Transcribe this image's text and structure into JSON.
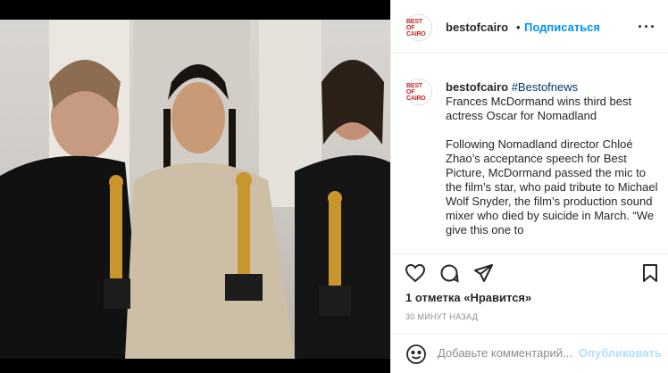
{
  "post": {
    "username": "bestofcairo",
    "avatar_text": "BEST OF CAIRO",
    "dot": "•",
    "follow_label": "Подписаться",
    "more_label": "···"
  },
  "caption": {
    "username": "bestofcairo",
    "hashtag": "#Bestofnews",
    "headline": "Frances McDormand wins third best actress Oscar for Nomadland",
    "body": "Following Nomadland director Chloé Zhao’s acceptance speech for Best Picture, McDormand passed the mic to the film’s star, who paid tribute to Michael Wolf Snyder, the film’s production sound mixer who died by suicide in March. “We give this one to"
  },
  "actions": {
    "like_icon": "heart-icon",
    "comment_icon": "comment-icon",
    "share_icon": "send-icon",
    "save_icon": "bookmark-icon"
  },
  "likes": {
    "count": "1 отметка",
    "suffix": " «Нравится»"
  },
  "timestamp": "30 МИНУТ НАЗАД",
  "comment": {
    "placeholder": "Добавьте комментарий...",
    "publish_label": "Опубликовать"
  },
  "colors": {
    "accent": "#0095f6",
    "publish_disabled": "#b2dffc",
    "hashtag": "#00376b"
  }
}
